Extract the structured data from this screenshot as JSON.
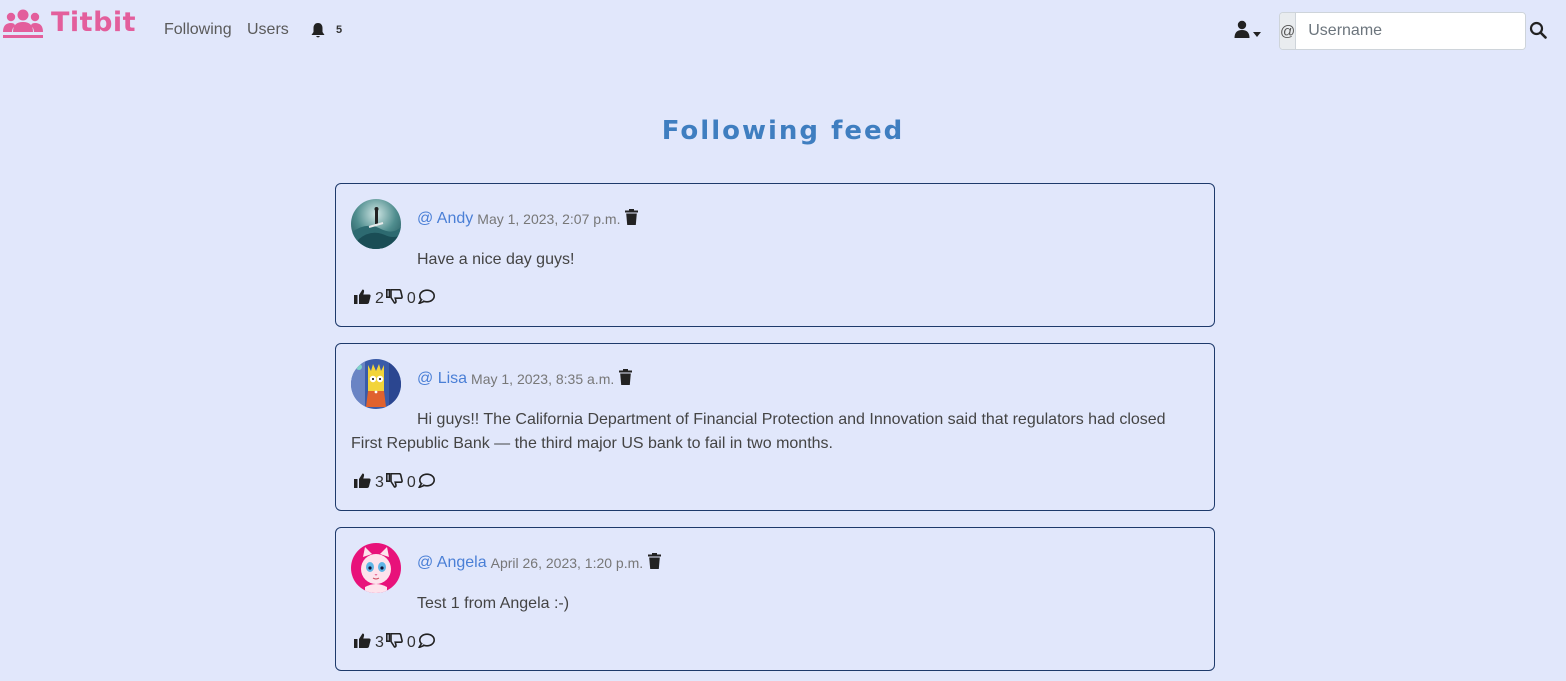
{
  "brand": {
    "name": "Titbit"
  },
  "nav": {
    "following": "Following",
    "users": "Users",
    "notifications_count": "5"
  },
  "search": {
    "prefix": "@",
    "placeholder": "Username"
  },
  "page": {
    "title": "Following feed"
  },
  "colors": {
    "brand": "#e35e9c",
    "accent": "#4a7fd6",
    "title": "#3f7ec0",
    "background": "#e1e7fb",
    "card_border": "#1e3a6b"
  },
  "posts": [
    {
      "username": "@ Andy",
      "timestamp": "May 1, 2023, 2:07 p.m.",
      "text": "Have a nice day guys!",
      "likes": "2",
      "dislikes": "0",
      "avatar_icon": "surfer-avatar"
    },
    {
      "username": "@ Lisa",
      "timestamp": "May 1, 2023, 8:35 a.m.",
      "text": "Hi guys!! The California Department of Financial Protection and Innovation said that regulators had closed First Republic Bank — the third major US bank to fail in two months.",
      "likes": "3",
      "dislikes": "0",
      "avatar_icon": "cartoon-avatar"
    },
    {
      "username": "@ Angela",
      "timestamp": "April 26, 2023, 1:20 p.m.",
      "text": "Test 1 from Angela :-)",
      "likes": "3",
      "dislikes": "0",
      "avatar_icon": "cat-avatar"
    }
  ]
}
